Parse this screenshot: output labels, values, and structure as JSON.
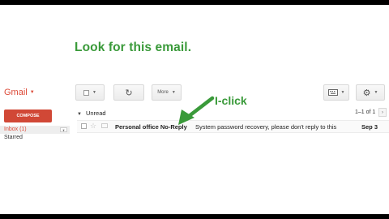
{
  "caption": "Look for this email.",
  "annotation": "I-click",
  "app": {
    "brand": "Gmail"
  },
  "toolbar": {
    "more_label": "More",
    "select_icon": "checkbox-icon",
    "refresh_icon": "refresh-icon",
    "input_tools_icon": "keyboard-icon",
    "settings_icon": "gear-icon"
  },
  "sidebar": {
    "compose_label": "COMPOSE",
    "items": [
      {
        "label": "Inbox (1)"
      },
      {
        "label": "Starred"
      }
    ]
  },
  "list": {
    "section_label": "Unread",
    "pager": "1–1 of 1",
    "rows": [
      {
        "sender": "Personal office No-Reply",
        "subject": "System password recovery, please don't reply to this e",
        "date": "Sep 3"
      }
    ]
  },
  "colors": {
    "annotation_green": "#3a9a3a",
    "brand_red": "#dd4b39",
    "compose_red": "#d14836",
    "frame": "#000000"
  }
}
